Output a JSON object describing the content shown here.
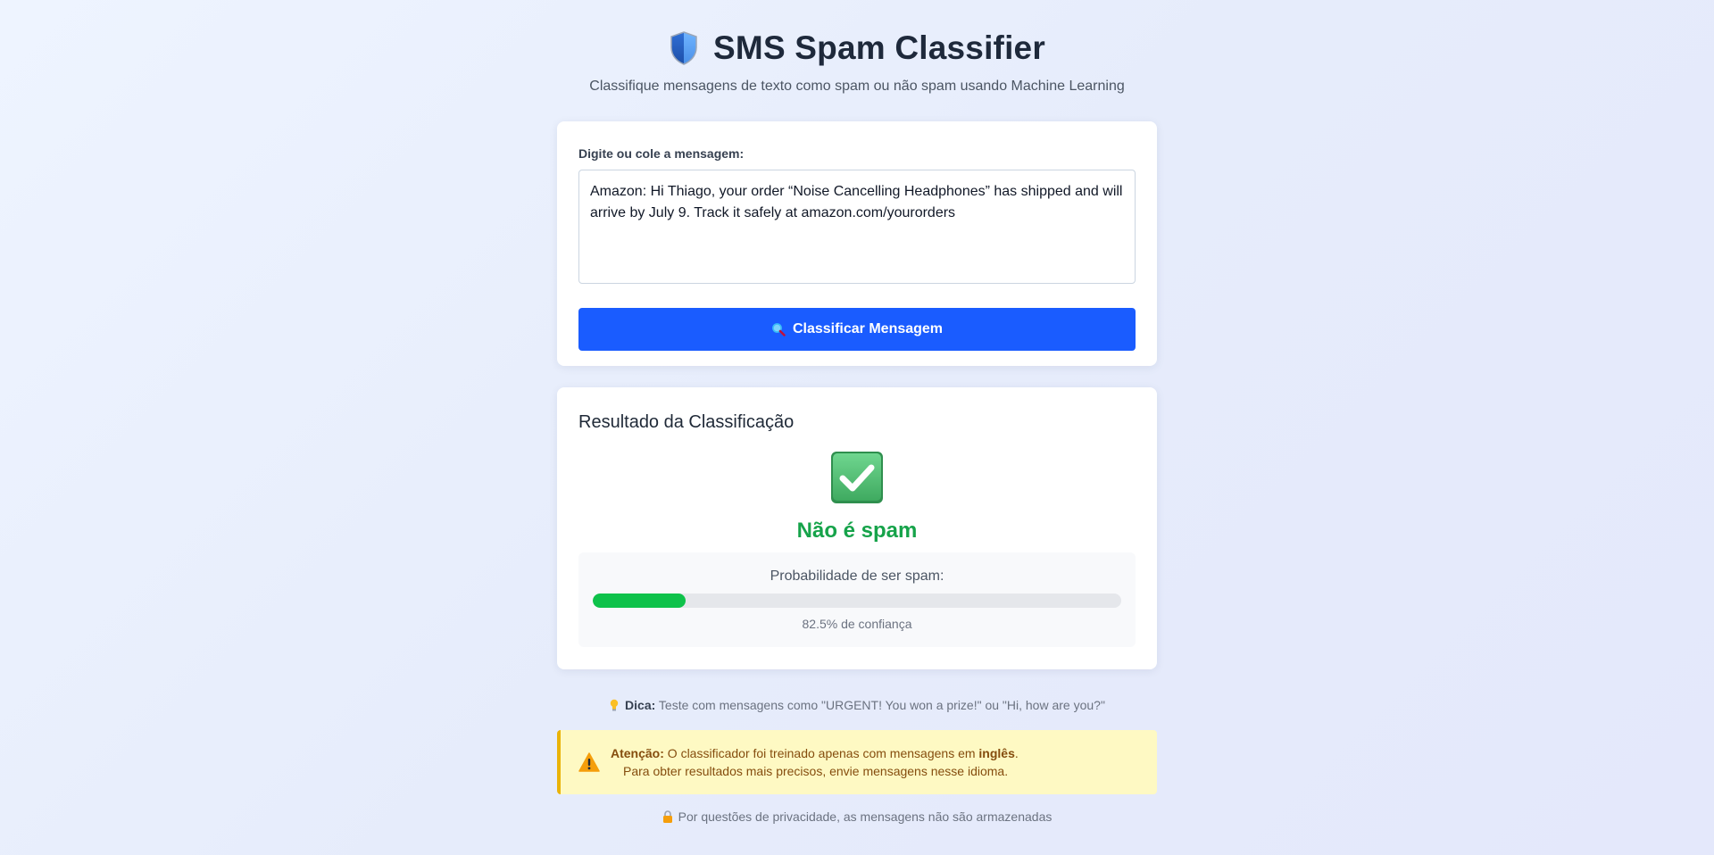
{
  "header": {
    "title": "SMS Spam Classifier",
    "subtitle": "Classifique mensagens de texto como spam ou não spam usando Machine Learning",
    "icon": "shield-icon"
  },
  "input_card": {
    "label": "Digite ou cole a mensagem:",
    "message_value": "Amazon: Hi Thiago, your order “Noise Cancelling Headphones” has shipped and will arrive by July 9. Track it safely at amazon.com/yourorders",
    "button_label": "Classificar Mensagem",
    "button_icon": "magnifier-icon",
    "button_color": "#1a5cff"
  },
  "result_card": {
    "title": "Resultado da Classificação",
    "icon": "check-mark-icon",
    "verdict": "Não é spam",
    "verdict_color": "#16a34a",
    "probability_label": "Probabilidade de ser spam:",
    "spam_probability_percent": 17.5,
    "confidence_text": "82.5% de confiança",
    "bar_color": "#0ec24a"
  },
  "tip": {
    "icon": "lightbulb-icon",
    "label": "Dica:",
    "text": "Teste com mensagens como \"URGENT! You won a prize!\" ou \"Hi, how are you?\""
  },
  "warning": {
    "icon": "warning-icon",
    "label": "Atenção:",
    "text_before": "O classificador foi treinado apenas com mensagens em",
    "emphasis": "inglês",
    "text_after": ".",
    "line2": "Para obter resultados mais precisos, envie mensagens nesse idioma.",
    "accent_color": "#eab308"
  },
  "privacy": {
    "icon": "lock-icon",
    "text": "Por questões de privacidade, as mensagens não são armazenadas"
  }
}
